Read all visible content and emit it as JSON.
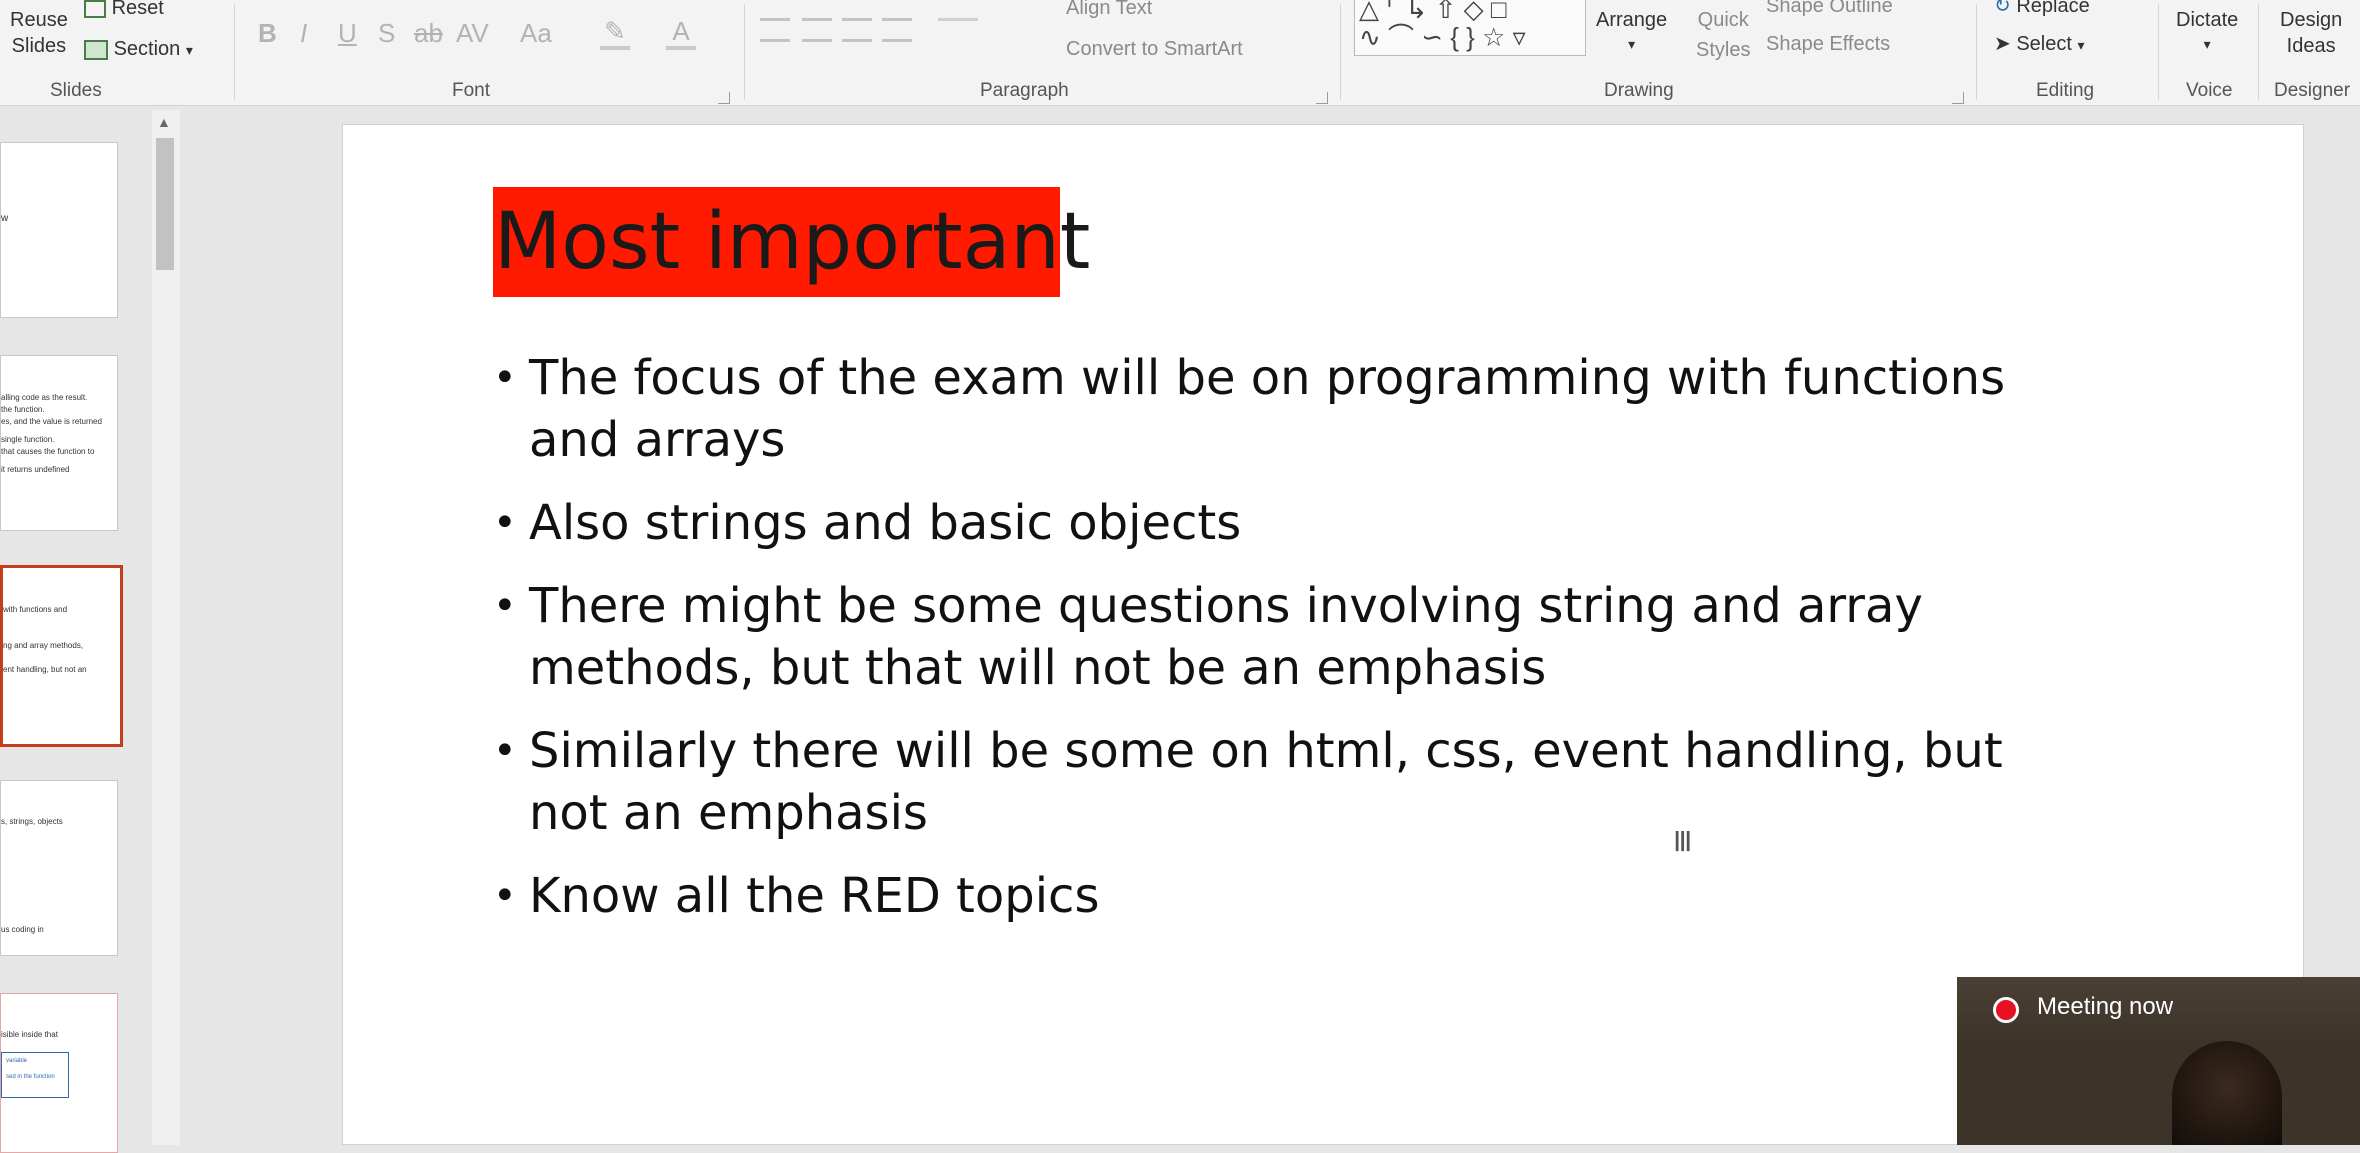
{
  "ribbon": {
    "slides": {
      "reuse_line1": "Reuse",
      "reuse_line2": "Slides",
      "reset": "Reset",
      "section": "Section",
      "group_label": "Slides"
    },
    "font": {
      "bold": "B",
      "italic": "I",
      "underline": "U",
      "shadow": "S",
      "strike": "ab",
      "spacing": "AV",
      "case": "Aa",
      "group_label": "Font"
    },
    "paragraph": {
      "align_text": "Align Text",
      "convert_smartart": "Convert to SmartArt",
      "group_label": "Paragraph"
    },
    "drawing": {
      "arrange": "Arrange",
      "quick_styles_line1": "Quick",
      "quick_styles_line2": "Styles",
      "shape_outline": "Shape Outline",
      "shape_effects": "Shape Effects",
      "group_label": "Drawing"
    },
    "editing": {
      "replace": "Replace",
      "select": "Select",
      "group_label": "Editing"
    },
    "voice": {
      "dictate": "Dictate",
      "group_label": "Voice"
    },
    "designer": {
      "ideas_line1": "Design",
      "ideas_line2": "Ideas",
      "group_label": "Designer"
    }
  },
  "thumbnails": [
    {
      "lines": [
        "w"
      ]
    },
    {
      "lines": [
        "alling code as the result.",
        "the function.",
        "es, and the value is returned",
        "single function.",
        "that causes the function to",
        "it returns undefined"
      ]
    },
    {
      "lines": [
        "with functions and",
        "ng and array methods,",
        "ent handling, but not an"
      ],
      "selected": true
    },
    {
      "lines": [
        "s, strings, objects",
        "us coding in"
      ]
    },
    {
      "lines": [
        "isible inside that",
        "variable",
        "sed in the function"
      ]
    }
  ],
  "slide": {
    "title": "Most important",
    "title_highlight_color": "#ff1a00",
    "bullets": [
      "The focus of the exam will be on programming with functions and arrays",
      "Also strings and basic objects",
      "There might be some questions involving string and array methods, but that will not be an emphasis",
      "Similarly there will be some on html, css, event handling, but not an emphasis",
      "Know all the RED topics"
    ]
  },
  "meeting": {
    "label": "Meeting now",
    "indicator_color": "#e81123"
  }
}
